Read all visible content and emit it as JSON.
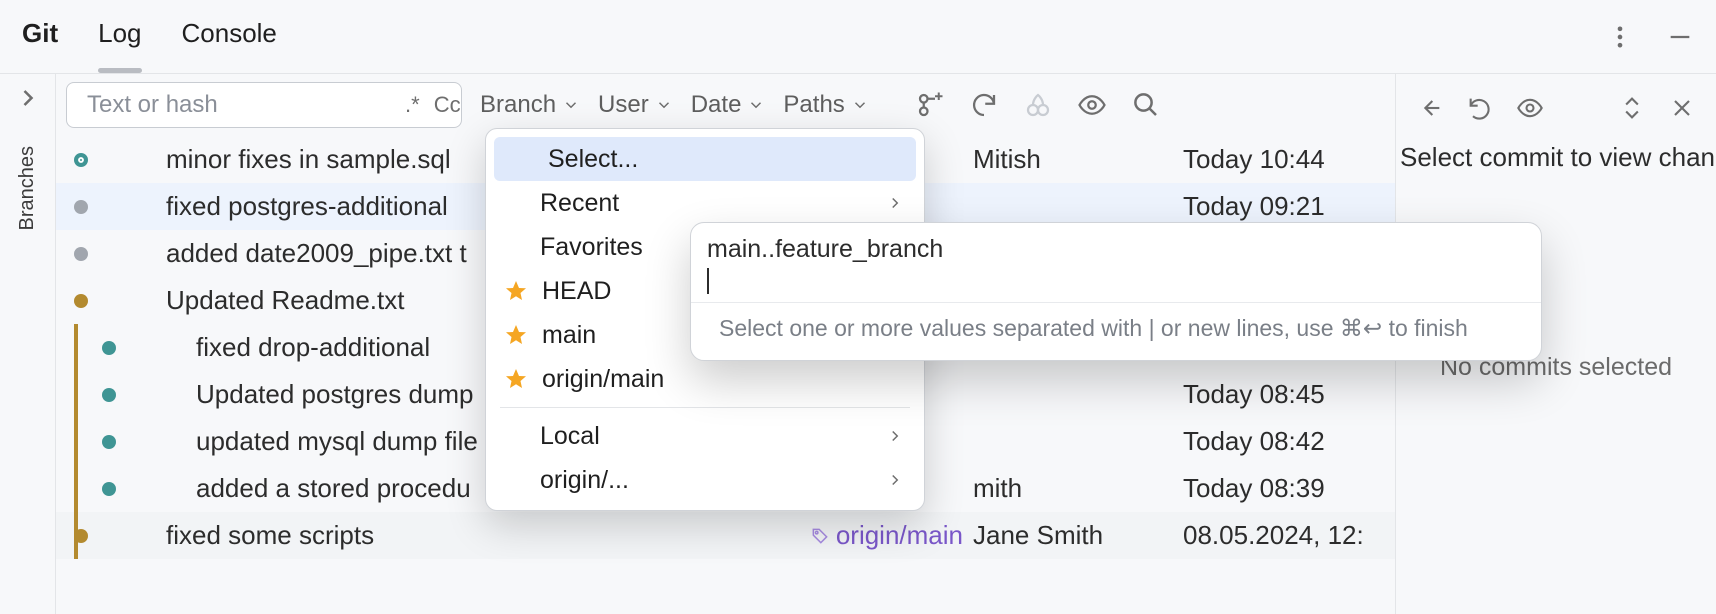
{
  "tabs": {
    "git": "Git",
    "log": "Log",
    "console": "Console"
  },
  "sidebar": {
    "branches": "Branches"
  },
  "search": {
    "placeholder": "Text or hash",
    "regex_label": ".*",
    "case_label": "Cc"
  },
  "filters": {
    "branch": "Branch",
    "user": "User",
    "date": "Date",
    "paths": "Paths"
  },
  "branch_popup": {
    "select": "Select...",
    "recent": "Recent",
    "favorites": "Favorites",
    "head": "HEAD",
    "main": "main",
    "origin_main": "origin/main",
    "local": "Local",
    "origin": "origin/..."
  },
  "branch_input": {
    "value": "main..feature_branch",
    "hint": "Select one or more values separated with | or new lines, use ⌘↩ to finish"
  },
  "detail": {
    "select_commit": "Select commit to view changes",
    "no_commits": "No commits selected"
  },
  "commits": [
    {
      "msg": "minor fixes in sample.sql",
      "author": "Mitish",
      "date": "Today 10:44",
      "tag": "",
      "dot": {
        "x": 18,
        "c": "teal"
      }
    },
    {
      "msg": "fixed postgres-additional",
      "author": "",
      "date": "Today 09:21",
      "tag": "",
      "sel": true,
      "dot": {
        "x": 18,
        "c": "grayf"
      }
    },
    {
      "msg": "added date2009_pipe.txt t",
      "author": "",
      "date": "",
      "tag": "",
      "dot": {
        "x": 18,
        "c": "grayf"
      }
    },
    {
      "msg": "Updated Readme.txt",
      "author": "",
      "date": "",
      "tag": "",
      "dot": {
        "x": 18,
        "c": "gold"
      },
      "indent": 0
    },
    {
      "msg": "fixed drop-additional",
      "author": "",
      "date": "",
      "tag": "",
      "dot": {
        "x": 46,
        "c": "tealf"
      },
      "indent": 1
    },
    {
      "msg": "Updated postgres dump",
      "author": "",
      "date": "Today 08:45",
      "tag": "",
      "dot": {
        "x": 46,
        "c": "tealf"
      },
      "indent": 1
    },
    {
      "msg": "updated mysql dump file",
      "author": "",
      "date": "Today 08:42",
      "tag": "",
      "dot": {
        "x": 46,
        "c": "tealf"
      },
      "indent": 1
    },
    {
      "msg": "added a stored procedu",
      "author": "mith",
      "date": "Today 08:39",
      "tag": "",
      "dot": {
        "x": 46,
        "c": "tealf"
      },
      "indent": 1
    },
    {
      "msg": "fixed some scripts",
      "author": "Jane Smith",
      "date": "08.05.2024, 12:",
      "tag": "origin/main",
      "alt": true,
      "dot": {
        "x": 18,
        "c": "gold"
      }
    }
  ]
}
